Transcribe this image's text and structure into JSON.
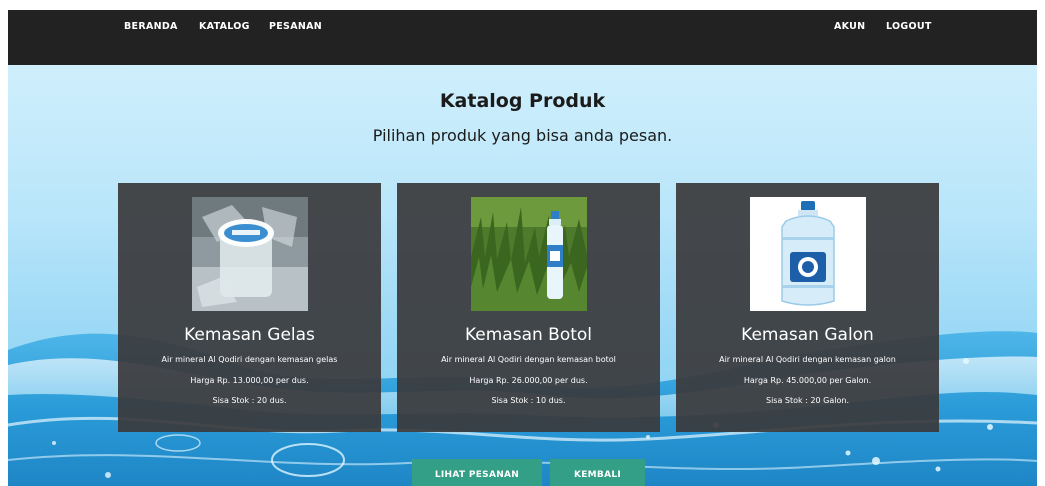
{
  "nav": {
    "left": [
      "BERANDA",
      "KATALOG",
      "PESANAN"
    ],
    "right": [
      "AKUN",
      "LOGOUT"
    ]
  },
  "header": {
    "title": "Katalog Produk",
    "subtitle": "Pilihan produk yang bisa anda pesan."
  },
  "products": [
    {
      "name": "Kemasan Gelas",
      "description": "Air mineral Al Qodiri dengan kemasan gelas",
      "price": "Harga Rp. 13.000,00 per dus.",
      "stock": "Sisa Stok : 20 dus."
    },
    {
      "name": "Kemasan Botol",
      "description": "Air mineral Al Qodiri dengan kemasan botol",
      "price": "Harga Rp. 26.000,00 per dus.",
      "stock": "Sisa Stok : 10 dus."
    },
    {
      "name": "Kemasan Galon",
      "description": "Air mineral Al Qodiri dengan kemasan galon",
      "price": "Harga Rp. 45.000,00 per Galon.",
      "stock": "Sisa Stok : 20 Galon."
    }
  ],
  "buttons": {
    "view_orders": "LIHAT PESANAN",
    "back": "KEMBALI"
  },
  "colors": {
    "navbar": "#222222",
    "card": "#3a3a3c",
    "button": "#339f86"
  }
}
